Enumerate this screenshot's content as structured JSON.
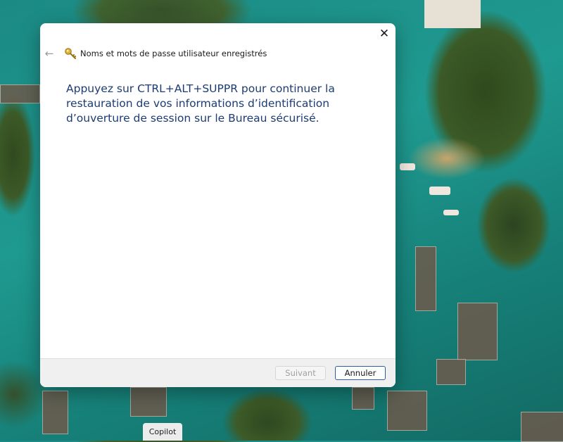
{
  "dialog": {
    "title": "Noms et mots de passe utilisateur enregistrés",
    "close_glyph": "✕",
    "back_glyph": "←",
    "message": "Appuyez sur CTRL+ALT+SUPPR pour continuer la restauration de vos informations d’identification d’ouverture de session sur le Bureau sécurisé.",
    "buttons": {
      "next_label": "Suivant",
      "cancel_label": "Annuler"
    },
    "icons": {
      "title_icon": "key-icon",
      "back_icon": "back-arrow-icon",
      "close_icon": "close-icon"
    }
  },
  "taskbar": {
    "copilot_label": "Copilot"
  },
  "colors": {
    "message_text": "#1c3c73",
    "cancel_border": "#2a5da8",
    "footer_bg": "#f0f0f0",
    "key_gold": "#d4a017"
  }
}
